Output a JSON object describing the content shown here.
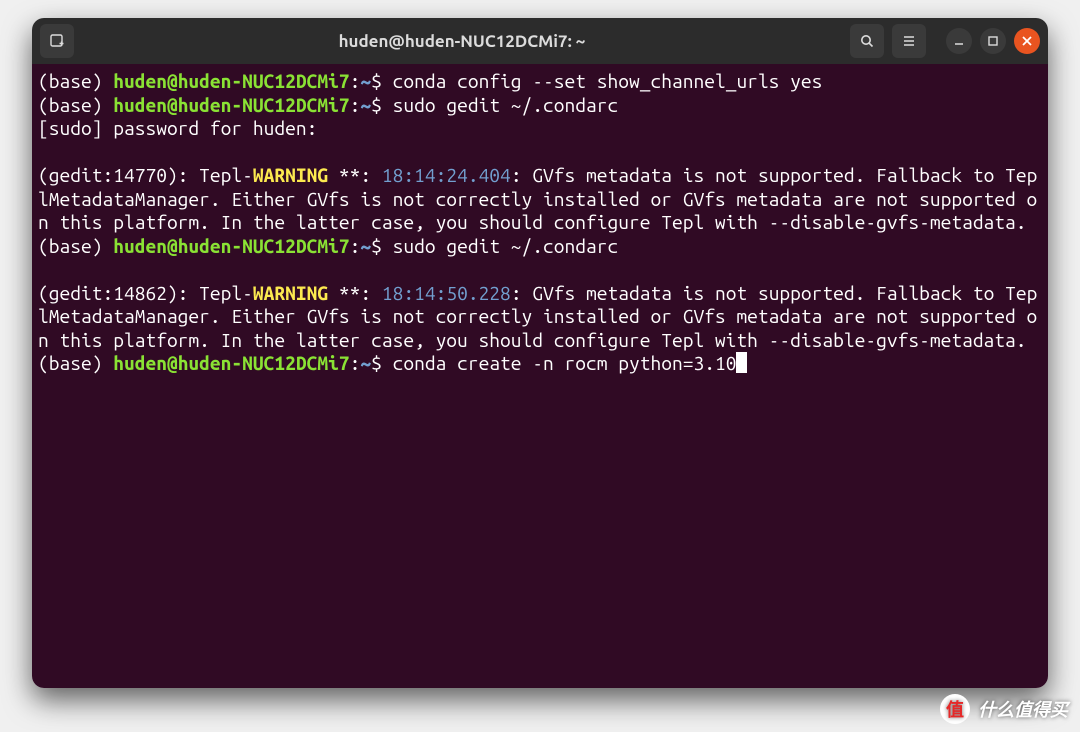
{
  "titlebar": {
    "title": "huden@huden-NUC12DCMi7: ~"
  },
  "colors": {
    "terminal_bg": "#300a24",
    "titlebar_bg": "#2c2c2c",
    "close_btn": "#e95420",
    "prompt_user": "#8ae234",
    "prompt_path": "#729fcf",
    "warning": "#fce94f",
    "timestamp": "#729fcf"
  },
  "prompt": {
    "env": "(base) ",
    "user_host": "huden@huden-NUC12DCMi7",
    "sep": ":",
    "path": "~",
    "dollar": "$ "
  },
  "lines": {
    "cmd1": "conda config --set show_channel_urls yes",
    "cmd2": "sudo gedit ~/.condarc",
    "sudo_prompt": "[sudo] password for huden: ",
    "blank": "",
    "warn1_prefix": "(gedit:14770): Tepl-",
    "warn_word": "WARNING",
    "warn1_mid": " **: ",
    "warn1_time": "18:14:24.404",
    "warn_tail": ": GVfs metadata is not supported. Fallback to TeplMetadataManager. Either GVfs is not correctly installed or GVfs metadata are not supported on this platform. In the latter case, you should configure Tepl with --disable-gvfs-metadata.",
    "cmd3": "sudo gedit ~/.condarc",
    "warn2_prefix": "(gedit:14862): Tepl-",
    "warn2_time": "18:14:50.228",
    "cmd4": "conda create -n rocm python=3.10"
  },
  "watermark": {
    "badge": "值",
    "text": "什么值得买"
  }
}
